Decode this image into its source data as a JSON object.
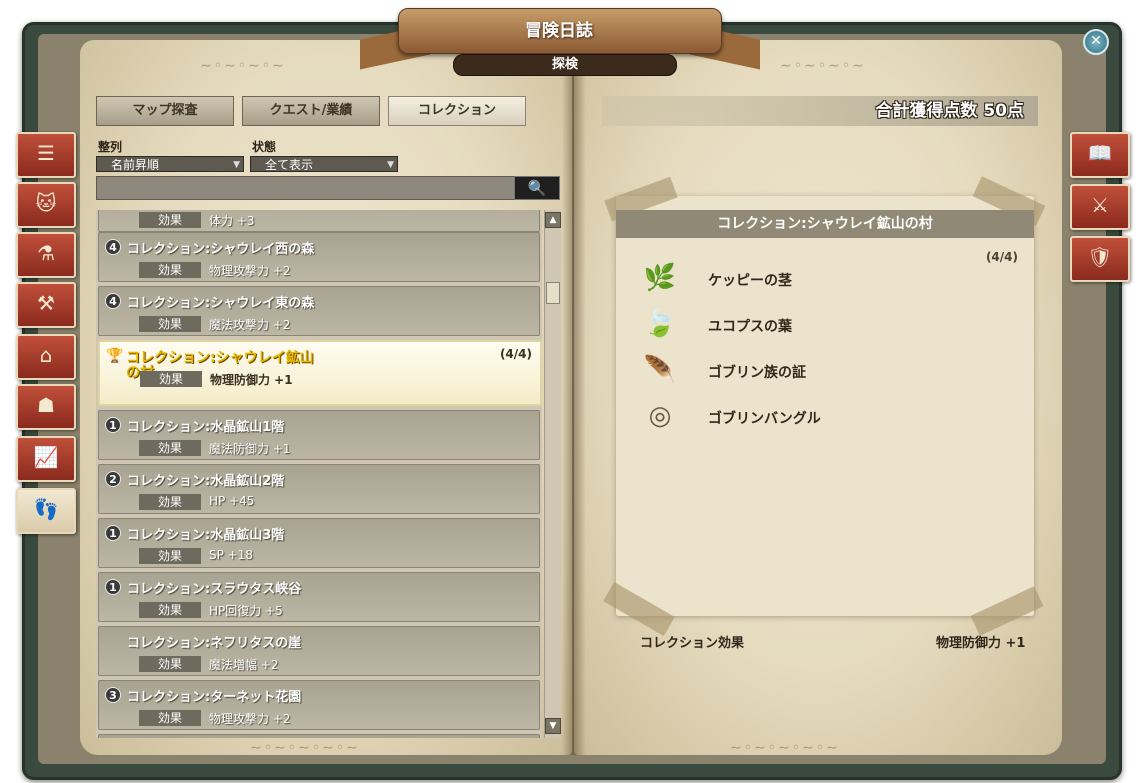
{
  "window": {
    "title": "冒険日誌",
    "subtitle": "探検",
    "close_icon": "close-icon"
  },
  "tabs": [
    {
      "label": "マップ探査",
      "active": false
    },
    {
      "label": "クエスト/業績",
      "active": false
    },
    {
      "label": "コレクション",
      "active": true
    }
  ],
  "filters": {
    "sort": {
      "label": "整列",
      "value": "名前昇順"
    },
    "status": {
      "label": "状態",
      "value": "全て表示"
    },
    "search": {
      "value": "",
      "icon": "search-icon"
    }
  },
  "list": {
    "effect_label": "効果",
    "partial_top": {
      "effect": "体力 +3"
    },
    "items": [
      {
        "badge": "4",
        "name": "コレクション:シャウレイ西の森",
        "effect": "物理攻撃力 +2"
      },
      {
        "badge": "4",
        "name": "コレクション:シャウレイ東の森",
        "effect": "魔法攻撃力 +2"
      },
      {
        "badge": "",
        "name": "コレクション:シャウレイ鉱山",
        "name2": "の村",
        "effect": "物理防御力 +1",
        "count": "(4/4)",
        "selected": true
      },
      {
        "badge": "1",
        "name": "コレクション:水晶鉱山1階",
        "effect": "魔法防御力 +1"
      },
      {
        "badge": "2",
        "name": "コレクション:水晶鉱山2階",
        "effect": "HP +45"
      },
      {
        "badge": "1",
        "name": "コレクション:水晶鉱山3階",
        "effect": "SP +18"
      },
      {
        "badge": "1",
        "name": "コレクション:スラウタス峡谷",
        "effect": "HP回復力 +5"
      },
      {
        "badge": "",
        "name": "コレクション:ネフリタスの崖",
        "effect": "魔法増幅 +2"
      },
      {
        "badge": "3",
        "name": "コレクション:ターネット花園",
        "effect": "物理攻撃力 +2"
      }
    ]
  },
  "left_side_tabs": [
    "list-icon",
    "cat-icon",
    "potion-icon",
    "anvil-icon",
    "house-icon",
    "monster-icon",
    "chart-icon",
    "footprints-icon"
  ],
  "right_side_tabs": [
    "book-icon",
    "crossed-swords-icon",
    "shield-icon"
  ],
  "right_page": {
    "score": "合計獲得点数 50点",
    "detail": {
      "title": "コレクション:シャウレイ鉱山の村",
      "count": "(4/4)",
      "materials": [
        {
          "name": "ケッピーの茎",
          "icon": "leek-icon",
          "color": "#6aa83a"
        },
        {
          "name": "ユコプスの葉",
          "icon": "leaf-icon",
          "color": "#4f8fa8"
        },
        {
          "name": "ゴブリン族の証",
          "icon": "feather-charm-icon",
          "color": "#8a6a4a"
        },
        {
          "name": "ゴブリンバングル",
          "icon": "bangle-icon",
          "color": "#6a5242"
        }
      ]
    },
    "footer": {
      "label": "コレクション効果",
      "value": "物理防御力 +1"
    }
  }
}
